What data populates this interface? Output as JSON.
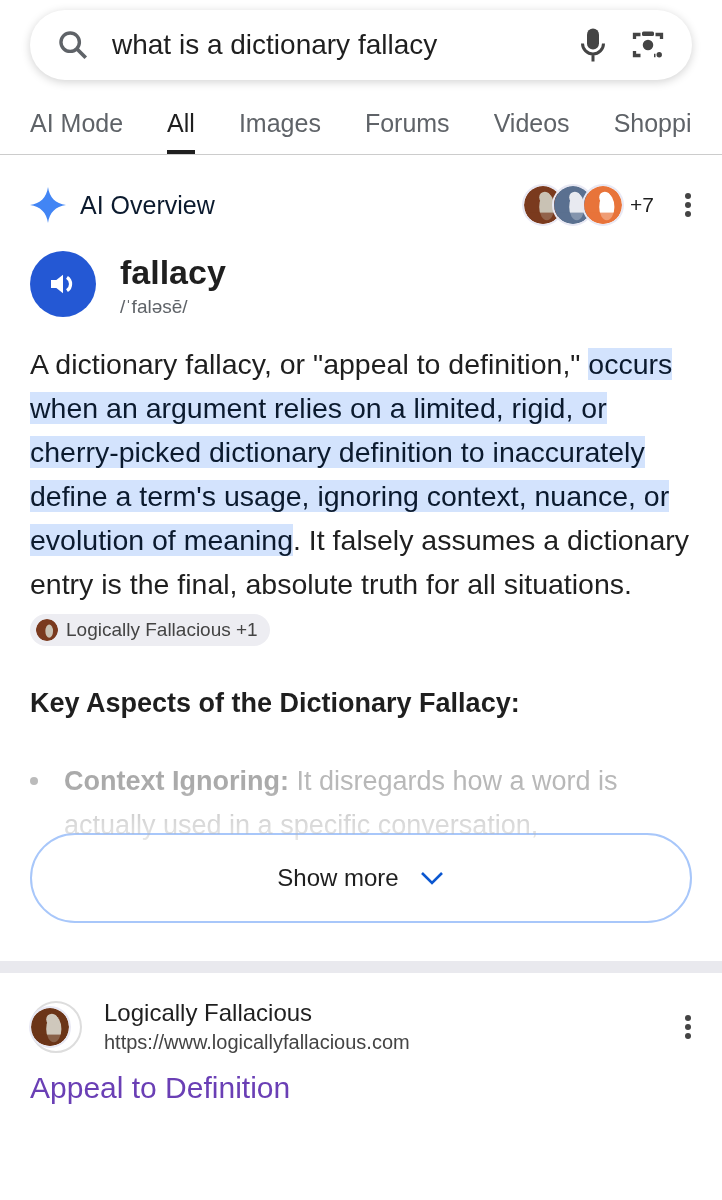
{
  "search": {
    "value": "what is a dictionary fallacy"
  },
  "tabs": [
    {
      "label": "AI Mode",
      "selected": false
    },
    {
      "label": "All",
      "selected": true
    },
    {
      "label": "Images",
      "selected": false
    },
    {
      "label": "Forums",
      "selected": false
    },
    {
      "label": "Videos",
      "selected": false
    },
    {
      "label": "Shoppi",
      "selected": false
    }
  ],
  "overview": {
    "title": "AI Overview",
    "sources_count": "+7",
    "word": "fallacy",
    "pronunciation": "/ˈfaləsē/",
    "paragraph": {
      "before": "A dictionary fallacy, or \"appeal to definition,\"",
      "highlighted": "occurs when an argument relies on a limited, rigid, or cherry-picked dictionary definition to inaccurately define a term's usage, ignoring context, nuance, or evolution of meaning",
      "after": ". It falsely assumes a dictionary entry is the final, absolute truth for all situations."
    },
    "citation": "Logically Fallacious +1",
    "heading": "Key Aspects of the Dictionary Fallacy:",
    "bullets": [
      "**Context Ignoring:** It disregards how a word is actually used in a specific conversation,"
    ],
    "show_more": "Show more"
  },
  "result": {
    "site": "Logically Fallacious",
    "url": "https://www.logicallyfallacious.com",
    "title": "Appeal to Definition"
  }
}
